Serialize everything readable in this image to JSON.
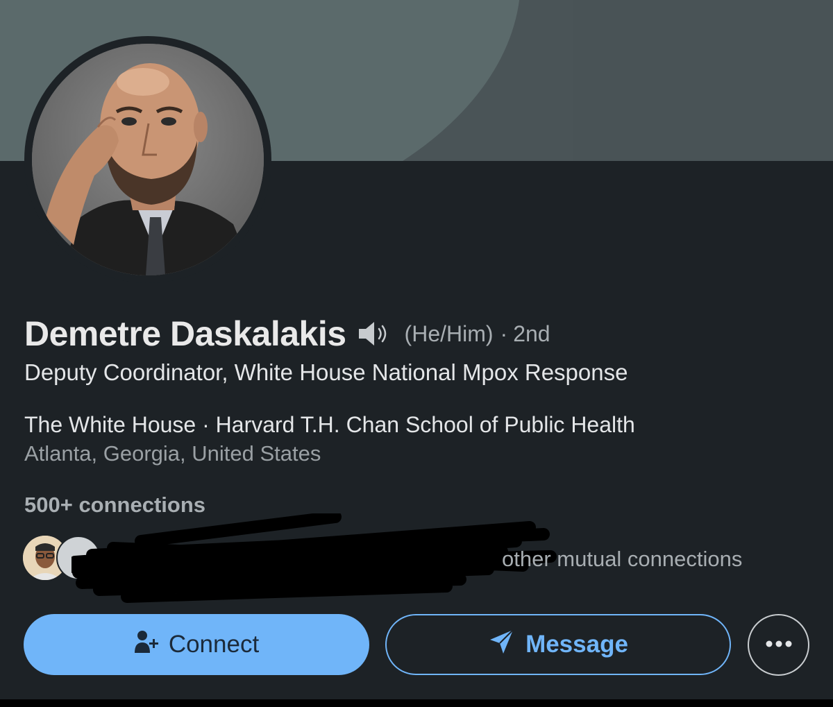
{
  "profile": {
    "name": "Demetre Daskalakis",
    "pronouns": "(He/Him)",
    "degree_separator": "·",
    "degree": "2nd",
    "headline": "Deputy Coordinator, White House National Mpox Response",
    "organizations": "The White House · Harvard T.H. Chan School of Public Health",
    "location": "Atlanta, Georgia, United States",
    "connections": "500+ connections",
    "mutual_connections_suffix": "other mutual connections"
  },
  "actions": {
    "connect_label": "Connect",
    "message_label": "Message",
    "more_icon": "ellipsis-icon"
  },
  "icons": {
    "pronunciation": "speaker-icon",
    "connect": "add-person-icon",
    "message": "paper-plane-icon"
  },
  "colors": {
    "background": "#1d2226",
    "accent_blue": "#70b5f9",
    "banner": "#5b6a6b"
  }
}
